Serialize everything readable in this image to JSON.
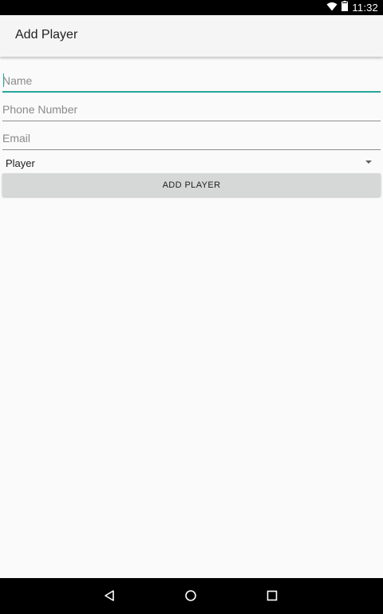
{
  "status_bar": {
    "time": "11:32",
    "icons": [
      "wifi-icon",
      "battery-icon"
    ]
  },
  "app_bar": {
    "title": "Add Player"
  },
  "form": {
    "name_placeholder": "Name",
    "phone_placeholder": "Phone Number",
    "email_placeholder": "Email",
    "role_selected": "Player",
    "submit_label": "ADD PLAYER"
  },
  "colors": {
    "accent": "#26a69a",
    "button_bg": "#d6d7d7"
  },
  "nav_bar": {
    "icons": [
      "back-icon",
      "home-icon",
      "recents-icon"
    ]
  }
}
